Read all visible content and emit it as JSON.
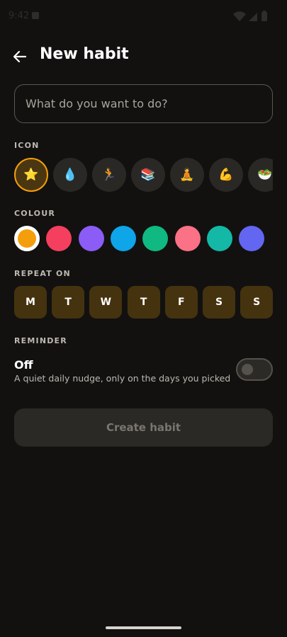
{
  "status_bar": {
    "time": "9:42",
    "icons": [
      "wifi-icon",
      "signal-icon",
      "battery-icon"
    ]
  },
  "header": {
    "title": "New habit",
    "back_icon": "arrow-left-icon"
  },
  "habit_name": {
    "placeholder": "What do you want to do?",
    "value": ""
  },
  "icon_section": {
    "label": "ICON",
    "options": [
      {
        "name": "star",
        "glyph": "⭐",
        "selected": true
      },
      {
        "name": "water-drop",
        "glyph": "💧",
        "selected": false
      },
      {
        "name": "runner",
        "glyph": "🏃",
        "selected": false
      },
      {
        "name": "books",
        "glyph": "📚",
        "selected": false
      },
      {
        "name": "meditation",
        "glyph": "🧘",
        "selected": false
      },
      {
        "name": "flexed-biceps",
        "glyph": "💪",
        "selected": false
      },
      {
        "name": "salad",
        "glyph": "🥗",
        "selected": false
      }
    ]
  },
  "colour_section": {
    "label": "COLOUR",
    "options": [
      {
        "color": "#f59e0b",
        "selected": true
      },
      {
        "color": "#f43f5e",
        "selected": false
      },
      {
        "color": "#8b5cf6",
        "selected": false
      },
      {
        "color": "#0ea5e9",
        "selected": false
      },
      {
        "color": "#10b981",
        "selected": false
      },
      {
        "color": "#fb7185",
        "selected": false
      },
      {
        "color": "#14b8a6",
        "selected": false
      },
      {
        "color": "#6366f1",
        "selected": false
      }
    ]
  },
  "repeat_section": {
    "label": "REPEAT ON",
    "days": [
      "M",
      "T",
      "W",
      "T",
      "F",
      "S",
      "S"
    ]
  },
  "reminder_section": {
    "label": "REMINDER",
    "state": "Off",
    "description": "A quiet daily nudge, only on the days you picked",
    "enabled": false
  },
  "create_button": {
    "label": "Create habit",
    "enabled": false
  },
  "colors": {
    "background": "#121110",
    "accent": "#f59e0b",
    "day_chip": "#45330f"
  }
}
